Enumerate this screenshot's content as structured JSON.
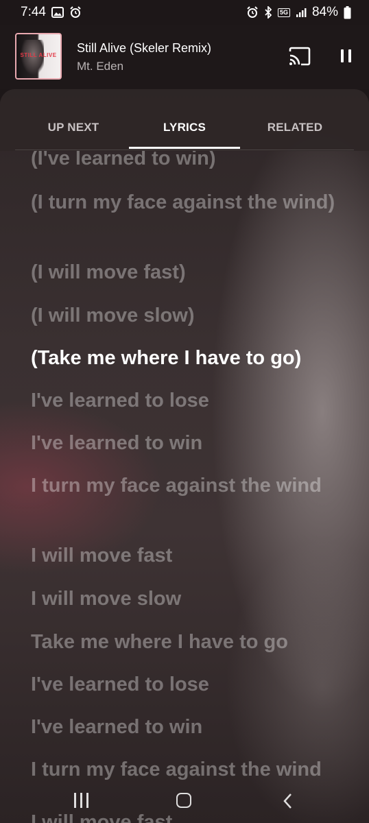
{
  "status_bar": {
    "time": "7:44",
    "battery_percent": "84%",
    "network_badge": "5G",
    "left_icons": [
      "gallery-icon",
      "alarm-icon"
    ],
    "right_icons": [
      "alarm-icon",
      "bluetooth-icon",
      "5g-signal-icon",
      "signal-icon",
      "battery-icon"
    ]
  },
  "now_playing": {
    "title": "Still Alive (Skeler Remix)",
    "artist": "Mt. Eden",
    "album_art_text": "STILL ALIVE",
    "album_art_accent": "#e9a9b0"
  },
  "tabs": [
    {
      "label": "UP NEXT",
      "selected": false
    },
    {
      "label": "LYRICS",
      "selected": true
    },
    {
      "label": "RELATED",
      "selected": false
    }
  ],
  "lyrics": {
    "lines": [
      "(I've learned to win)",
      "(I turn my face against the wind)",
      "(I will move fast)",
      "(I will move slow)",
      "(Take me where I have to go)",
      "I've learned to lose",
      "I've learned to win",
      "I turn my face against the wind",
      "I will move fast",
      "I will move slow",
      "Take me where I have to go",
      "I've learned to lose",
      "I've learned to win",
      "I turn my face against the wind",
      "I will move fast"
    ],
    "active_index": 4
  },
  "nav_bar": {
    "icons": [
      "recents-icon",
      "home-icon",
      "back-icon"
    ]
  },
  "colors": {
    "background": "#1d1718",
    "active_lyric": "#ffffff",
    "inactive_lyric": "rgba(255,255,255,0.34)",
    "album_art_text": "#e23b48"
  }
}
